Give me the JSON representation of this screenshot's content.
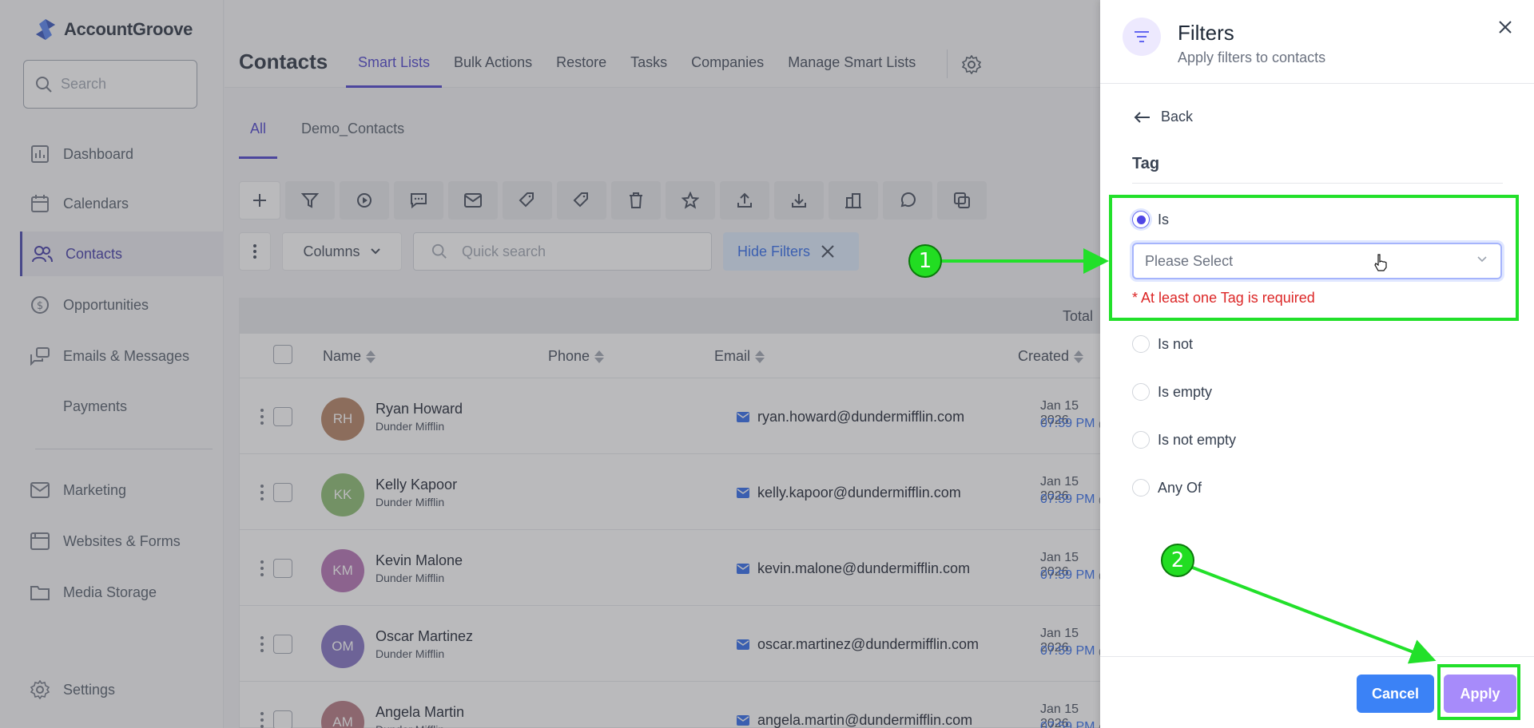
{
  "brand": {
    "name": "AccountGroove"
  },
  "sidebar": {
    "search_placeholder": "Search",
    "items": [
      {
        "label": "Dashboard",
        "icon": "dashboard-icon",
        "active": false
      },
      {
        "label": "Calendars",
        "icon": "calendar-icon",
        "active": false
      },
      {
        "label": "Contacts",
        "icon": "contacts-icon",
        "active": true
      },
      {
        "label": "Opportunities",
        "icon": "dollar-icon",
        "active": false
      },
      {
        "label": "Emails & Messages",
        "icon": "messages-icon",
        "active": false
      },
      {
        "label": "Payments",
        "icon": "",
        "active": false
      },
      {
        "label": "Marketing",
        "icon": "mail-icon",
        "active": false
      },
      {
        "label": "Websites & Forms",
        "icon": "browser-icon",
        "active": false
      },
      {
        "label": "Media Storage",
        "icon": "folder-icon",
        "active": false
      },
      {
        "label": "Settings",
        "icon": "gear-icon",
        "active": false
      }
    ]
  },
  "header": {
    "title": "Contacts",
    "tabs": [
      "Smart Lists",
      "Bulk Actions",
      "Restore",
      "Tasks",
      "Companies",
      "Manage Smart Lists"
    ]
  },
  "subtabs": [
    "All",
    "Demo_Contacts"
  ],
  "controls": {
    "columns_label": "Columns",
    "quick_search_placeholder": "Quick search",
    "hide_filters_label": "Hide Filters"
  },
  "table": {
    "total_label": "Total",
    "columns": [
      "Name",
      "Phone",
      "Email",
      "Created"
    ],
    "rows": [
      {
        "initials": "RH",
        "name": "Ryan Howard",
        "company": "Dunder Mifflin",
        "email": "ryan.howard@dundermifflin.com",
        "date": "Jan 15 2026",
        "time": "07:59 PM",
        "tz": "(MS",
        "color": "#b07a5a"
      },
      {
        "initials": "KK",
        "name": "Kelly Kapoor",
        "company": "Dunder Mifflin",
        "email": "kelly.kapoor@dundermifflin.com",
        "date": "Jan 15 2026",
        "time": "07:59 PM",
        "tz": "(MS",
        "color": "#86b86a"
      },
      {
        "initials": "KM",
        "name": "Kevin Malone",
        "company": "Dunder Mifflin",
        "email": "kevin.malone@dundermifflin.com",
        "date": "Jan 15 2026",
        "time": "07:59 PM",
        "tz": "(MS",
        "color": "#b06ab0"
      },
      {
        "initials": "OM",
        "name": "Oscar Martinez",
        "company": "Dunder Mifflin",
        "email": "oscar.martinez@dundermifflin.com",
        "date": "Jan 15 2026",
        "time": "07:59 PM",
        "tz": "(MS",
        "color": "#7a6ac0"
      },
      {
        "initials": "AM",
        "name": "Angela Martin",
        "company": "Dunder Mifflin",
        "email": "angela.martin@dundermifflin.com",
        "date": "Jan 15 2026",
        "time": "07:59 PM",
        "tz": "(MS",
        "color": "#b0707a"
      }
    ]
  },
  "filter_panel": {
    "title": "Filters",
    "subtitle": "Apply filters to contacts",
    "back_label": "Back",
    "field_label": "Tag",
    "options": [
      "Is",
      "Is not",
      "Is empty",
      "Is not empty",
      "Any Of"
    ],
    "selected_option": "Is",
    "select_placeholder": "Please Select",
    "error_text": "* At least one Tag is required",
    "cancel_label": "Cancel",
    "apply_label": "Apply"
  },
  "annotations": {
    "step1": "1",
    "step2": "2",
    "color": "#22e02a"
  }
}
